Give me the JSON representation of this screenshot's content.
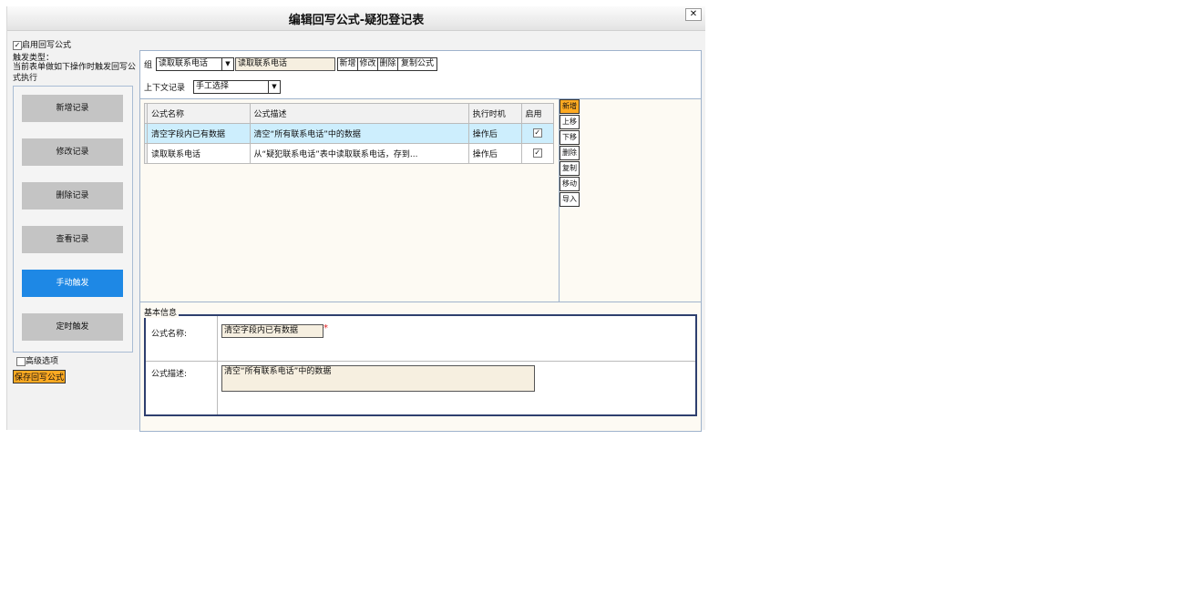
{
  "dialog": {
    "title": "编辑回写公式-疑犯登记表",
    "close_label": "✕"
  },
  "left": {
    "enable_label": "启用回写公式",
    "enable_checked": true,
    "trigger_type_label": "触发类型：",
    "trigger_desc": "当前表单做如下操作时触发回写公式执行",
    "triggers": [
      "新增记录",
      "修改记录",
      "删除记录",
      "查看记录",
      "手动触发",
      "定时触发"
    ],
    "active_trigger": "手动触发",
    "advanced_label": "高级选项",
    "save_label": "保存回写公式"
  },
  "group_row": {
    "label": "组",
    "selected": "读取联系电话",
    "name_value": "读取联系电话",
    "buttons": [
      "新增",
      "修改",
      "删除",
      "复制公式"
    ]
  },
  "context_row": {
    "label": "上下文记录",
    "selected": "手工选择"
  },
  "table": {
    "headers": [
      "公式名称",
      "公式描述",
      "执行时机",
      "启用"
    ],
    "rows": [
      {
        "name": "清空字段内已有数据",
        "desc": "清空“所有联系电话”中的数据",
        "timing": "操作后",
        "enabled": true
      },
      {
        "name": "读取联系电话",
        "desc": "从“疑犯联系电话”表中读取联系电话，存到...",
        "timing": "操作后",
        "enabled": true
      }
    ]
  },
  "side_buttons": [
    "新增",
    "上移",
    "下移",
    "删除",
    "复制",
    "移动",
    "导入"
  ],
  "basic_info": {
    "legend": "基本信息",
    "name_label": "公式名称:",
    "name_value": "清空字段内已有数据",
    "required_mark": "*",
    "desc_label": "公式描述:",
    "desc_value": "清空“所有联系电话”中的数据"
  },
  "colors": {
    "accent_blue": "#1e88e5",
    "highlight_orange": "#ffaa22",
    "selected_row": "#cdeefd"
  }
}
